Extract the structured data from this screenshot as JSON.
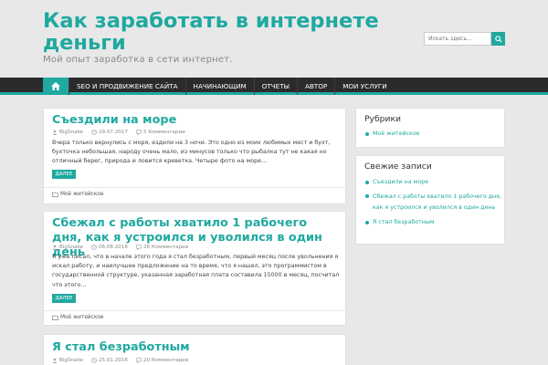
{
  "header": {
    "title": "Как заработать в интернете деньги",
    "description": "Мой опыт заработка в сети интернет."
  },
  "search": {
    "placeholder": "Искать здесь..."
  },
  "nav": {
    "items": [
      "SEO И ПРОДВИЖЕНИЕ САЙТА",
      "НАЧИНАЮЩИМ",
      "ОТЧЕТЫ",
      "АВТОР",
      "МОИ УСЛУГИ"
    ]
  },
  "posts": [
    {
      "title": "Съездили на море",
      "author": "BigSnake",
      "date": "29.07.2017",
      "comments": "5 Комментарии",
      "excerpt": "Вчера только вернулись с моря, ездили на 3 ночи. Это одно из моих любимых мест и бухт, бухточка небольшая, народу очень мало, из минусов только что рыбалка тут не какая но отличный берег, природа и ловится креветка. Четыре фото на море…",
      "more": "ДАЛЕЕ",
      "category": "Моё житейское"
    },
    {
      "title": "Сбежал с работы хватило 1 рабочего дня, как я устроился и уволился в один день",
      "author": "BigSnake",
      "date": "06.08.2016",
      "comments": "28 Комментарии",
      "excerpt": "Я уже писал, что в начале этого года я стал безработным, первый месяц после увольнения я искал работу, и наилучшее предложение на то время, что я нашел, это программистом в государственной структуре, указанная заработная плата составила 15000 в месяц, посчитал что этого…",
      "more": "ДАЛЕЕ",
      "category": "Моё житейское"
    },
    {
      "title": "Я стал безработным",
      "author": "BigSnake",
      "date": "25.01.2016",
      "comments": "20 Комментарии"
    }
  ],
  "sidebar": {
    "rubrics": {
      "title": "Рубрики",
      "items": [
        "Моё житейское"
      ]
    },
    "recent": {
      "title": "Свежие записи",
      "items": [
        "Съездили на море",
        "Сбежал с работы хватило 1 рабочего дня, как я устроился и уволился в один день",
        "Я стал безработным"
      ]
    }
  },
  "colors": {
    "accent": "#1fa9a0",
    "nav_bg": "#2b2b2b",
    "page_bg": "#e8e8e8"
  },
  "icons": [
    "search-icon",
    "home-icon",
    "user-icon",
    "clock-icon",
    "comment-icon",
    "folder-icon"
  ]
}
